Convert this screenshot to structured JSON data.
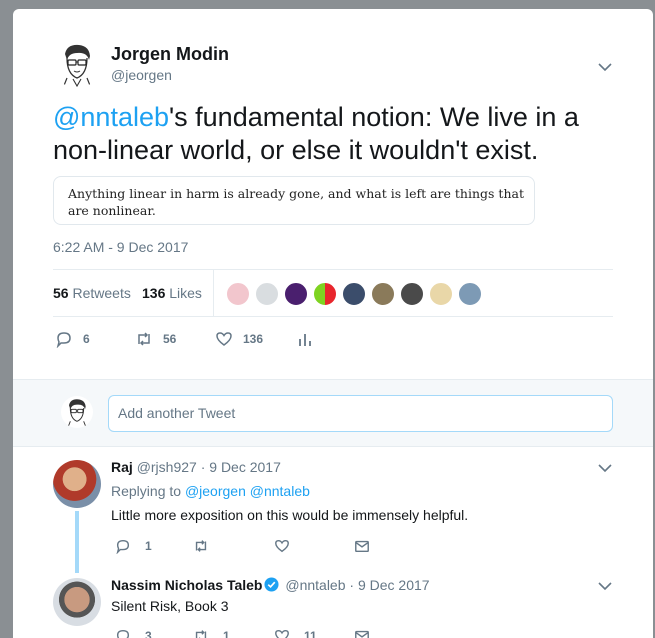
{
  "main_tweet": {
    "author_name": "Jorgen Modin",
    "author_handle": "@jeorgen",
    "text_mention": "@nntaleb",
    "text_rest": "'s fundamental notion: We live in a non-linear world, or else it wouldn't exist.",
    "quote_text": "Anything linear in harm is already gone, and what is left are things that are nonlinear.",
    "timestamp": "6:22 AM - 9 Dec 2017",
    "retweets_count": "56",
    "retweets_label": "Retweets",
    "likes_count": "136",
    "likes_label": "Likes",
    "actions": {
      "replies": "6",
      "retweets": "56",
      "likes": "136"
    }
  },
  "reply_box": {
    "placeholder": "Add another Tweet"
  },
  "replies": [
    {
      "name": "Raj",
      "handle": "@rjsh927",
      "date": "· 9 Dec 2017",
      "replying_label": "Replying to",
      "replying_to_1": "@jeorgen",
      "replying_to_2": "@nntaleb",
      "text": "Little more exposition on this would be immensely helpful.",
      "actions": {
        "replies": "1",
        "retweets": "",
        "likes": ""
      }
    },
    {
      "name": "Nassim Nicholas Taleb",
      "handle": "@nntaleb",
      "date": "· 9 Dec 2017",
      "text": "Silent Risk, Book 3",
      "actions": {
        "replies": "3",
        "retweets": "1",
        "likes": "11"
      }
    }
  ],
  "colors": {
    "link": "#1da1f2",
    "muted": "#657786",
    "thread": "#a4d9f9",
    "verified": "#1da1f2"
  }
}
